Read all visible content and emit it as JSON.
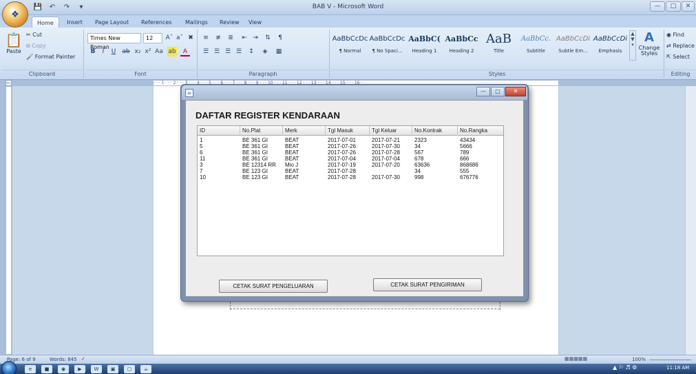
{
  "window": {
    "title": "BAB V - Microsoft Word"
  },
  "tabs": [
    "Home",
    "Insert",
    "Page Layout",
    "References",
    "Mailings",
    "Review",
    "View"
  ],
  "ribbon": {
    "clipboard": {
      "paste": "Paste",
      "cut": "Cut",
      "copy": "Copy",
      "format_painter": "Format Painter",
      "label": "Clipboard"
    },
    "font": {
      "name": "Times New Roman",
      "size": "12",
      "label": "Font"
    },
    "paragraph": {
      "label": "Paragraph"
    },
    "styles": {
      "label": "Styles",
      "change_styles": "Change Styles",
      "items": [
        {
          "sample": "AaBbCcDc",
          "name": "¶ Normal"
        },
        {
          "sample": "AaBbCcDc",
          "name": "¶ No Spaci..."
        },
        {
          "sample": "AaBbC(",
          "name": "Heading 1"
        },
        {
          "sample": "AaBbCc",
          "name": "Heading 2"
        },
        {
          "sample": "AaB",
          "name": "Title"
        },
        {
          "sample": "AaBbCc.",
          "name": "Subtitle"
        },
        {
          "sample": "AaBbCcDi",
          "name": "Subtle Em..."
        },
        {
          "sample": "AaBbCcDi",
          "name": "Emphasis"
        }
      ]
    },
    "editing": {
      "find": "Find",
      "replace": "Replace",
      "select": "Select",
      "label": "Editing"
    }
  },
  "dialog": {
    "heading": "DAFTAR REGISTER KENDARAAN",
    "columns": [
      "ID",
      "No.Plat",
      "Merk",
      "Tgl Masuk",
      "Tgl Keluar",
      "No.Kontrak",
      "No.Rangka"
    ],
    "rows": [
      [
        "1",
        "BE 361 GI",
        "BEAT",
        "2017-07-01",
        "2017-07-21",
        "2323",
        "43434"
      ],
      [
        "5",
        "BE 361 GI",
        "BEAT",
        "2017-07-26",
        "2017-07-30",
        "34",
        "5666"
      ],
      [
        "6",
        "BE 361 GI",
        "BEAT",
        "2017-07-26",
        "2017-07-28",
        "567",
        "789"
      ],
      [
        "11",
        "BE 361 GI",
        "BEAT",
        "2017-07-04",
        "2017-07-04",
        "678",
        "666"
      ],
      [
        "3",
        "BE 12314 RR",
        "Mio J",
        "2017-07-19",
        "2017-07-20",
        "63636",
        "868686"
      ],
      [
        "7",
        "BE 123 GI",
        "BEAT",
        "2017-07-28",
        "",
        "34",
        "555"
      ],
      [
        "10",
        "BE 123 GI",
        "BEAT",
        "2017-07-28",
        "2017-07-30",
        "998",
        "676776"
      ]
    ],
    "btn_left": "CETAK SURAT PENGELUARAN",
    "btn_right": "CETAK SURAT PENGIRIMAN"
  },
  "statusbar": {
    "page": "Page: 6 of 9",
    "words": "Words: 845",
    "zoom": "100%"
  },
  "clock": "11:18 AM"
}
